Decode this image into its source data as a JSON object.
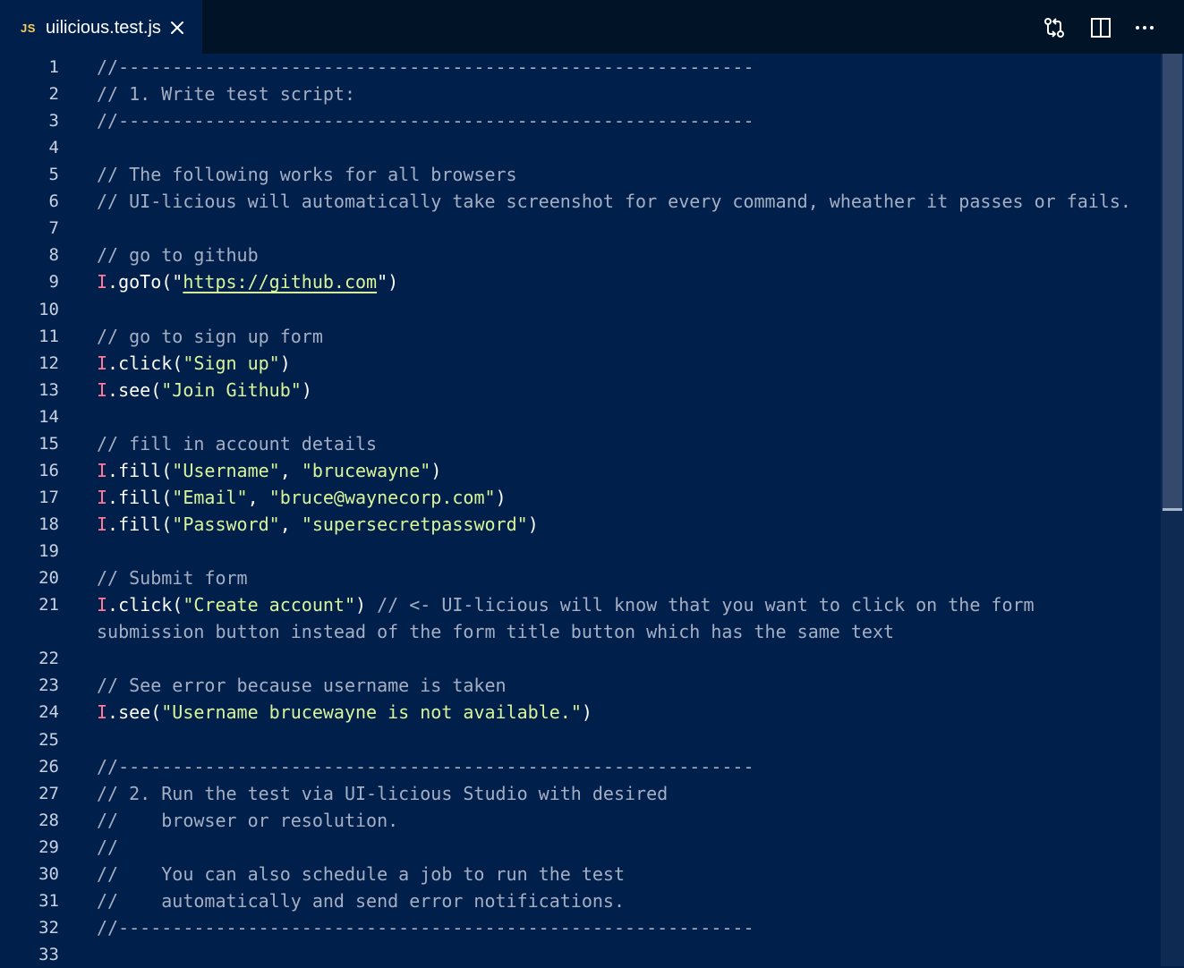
{
  "tab": {
    "language_badge": "JS",
    "filename": "uilicious.test.js",
    "close_icon": "close-icon"
  },
  "toolbar": {
    "icons": [
      "compare-changes-icon",
      "split-editor-icon",
      "more-actions-icon"
    ]
  },
  "editor": {
    "line_numbers": [
      "1",
      "2",
      "3",
      "4",
      "5",
      "6",
      "7",
      "8",
      "9",
      "10",
      "11",
      "12",
      "13",
      "14",
      "15",
      "16",
      "17",
      "18",
      "19",
      "20",
      "21",
      "22",
      "23",
      "24",
      "25",
      "26",
      "27",
      "28",
      "29",
      "30",
      "31",
      "32",
      "33"
    ],
    "lines": [
      [
        [
          "c",
          "//-----------------------------------------------------------"
        ]
      ],
      [
        [
          "c",
          "// 1. Write test script:"
        ]
      ],
      [
        [
          "c",
          "//-----------------------------------------------------------"
        ]
      ],
      [],
      [
        [
          "c",
          "// The following works for all browsers"
        ]
      ],
      [
        [
          "c",
          "// UI-licious will automatically take screenshot for every command, wheather it passes or fails."
        ]
      ],
      [],
      [
        [
          "c",
          "// go to github"
        ]
      ],
      [
        [
          "k",
          "I"
        ],
        [
          "p",
          ".goTo(\""
        ],
        [
          "u",
          "https://github.com"
        ],
        [
          "p",
          "\")"
        ]
      ],
      [],
      [
        [
          "c",
          "// go to sign up form"
        ]
      ],
      [
        [
          "k",
          "I"
        ],
        [
          "p",
          ".click("
        ],
        [
          "s",
          "\"Sign up\""
        ],
        [
          "p",
          ")"
        ]
      ],
      [
        [
          "k",
          "I"
        ],
        [
          "p",
          ".see("
        ],
        [
          "s",
          "\"Join Github\""
        ],
        [
          "p",
          ")"
        ]
      ],
      [],
      [
        [
          "c",
          "// fill in account details"
        ]
      ],
      [
        [
          "k",
          "I"
        ],
        [
          "p",
          ".fill("
        ],
        [
          "s",
          "\"Username\""
        ],
        [
          "p",
          ", "
        ],
        [
          "s",
          "\"brucewayne\""
        ],
        [
          "p",
          ")"
        ]
      ],
      [
        [
          "k",
          "I"
        ],
        [
          "p",
          ".fill("
        ],
        [
          "s",
          "\"Email\""
        ],
        [
          "p",
          ", "
        ],
        [
          "s",
          "\"bruce@waynecorp.com\""
        ],
        [
          "p",
          ")"
        ]
      ],
      [
        [
          "k",
          "I"
        ],
        [
          "p",
          ".fill("
        ],
        [
          "s",
          "\"Password\""
        ],
        [
          "p",
          ", "
        ],
        [
          "s",
          "\"supersecretpassword\""
        ],
        [
          "p",
          ")"
        ]
      ],
      [],
      [
        [
          "c",
          "// Submit form"
        ]
      ],
      [
        [
          "k",
          "I"
        ],
        [
          "p",
          ".click("
        ],
        [
          "s",
          "\"Create account\""
        ],
        [
          "p",
          ") "
        ],
        [
          "c",
          "// <- UI-licious will know that you want to click on the form"
        ]
      ],
      [
        [
          "c",
          "submission button instead of the form title button which has the same text"
        ]
      ],
      [],
      [
        [
          "c",
          "// See error because username is taken"
        ]
      ],
      [
        [
          "k",
          "I"
        ],
        [
          "p",
          ".see("
        ],
        [
          "s",
          "\"Username brucewayne is not available.\""
        ],
        [
          "p",
          ")"
        ]
      ],
      [],
      [
        [
          "c",
          "//-----------------------------------------------------------"
        ]
      ],
      [
        [
          "c",
          "// 2. Run the test via UI-licious Studio with desired"
        ]
      ],
      [
        [
          "c",
          "//    browser or resolution."
        ]
      ],
      [
        [
          "c",
          "//"
        ]
      ],
      [
        [
          "c",
          "//    You can also schedule a job to run the test"
        ]
      ],
      [
        [
          "c",
          "//    automatically and send error notifications."
        ]
      ],
      [
        [
          "c",
          "//-----------------------------------------------------------"
        ]
      ],
      []
    ],
    "line_number_rows": [
      0,
      1,
      2,
      3,
      4,
      5,
      6,
      7,
      8,
      9,
      10,
      11,
      12,
      13,
      14,
      15,
      16,
      17,
      18,
      19,
      20,
      22,
      23,
      24,
      25,
      26,
      27,
      28,
      29,
      30,
      31,
      32,
      33
    ]
  }
}
